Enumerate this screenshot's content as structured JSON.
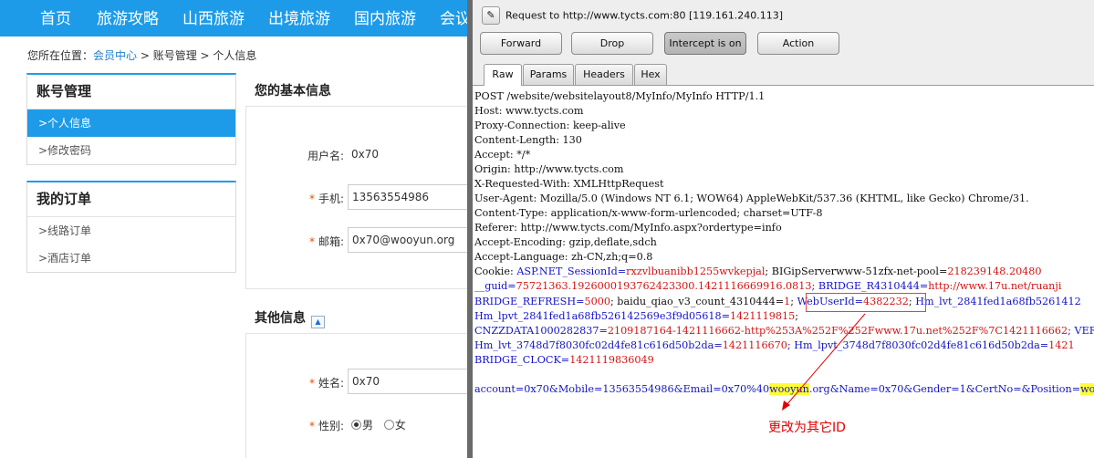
{
  "site": {
    "nav": [
      "首页",
      "旅游攻略",
      "山西旅游",
      "出境旅游",
      "国内旅游",
      "会议"
    ],
    "breadcrumb": {
      "prefix": "您所在位置：",
      "link": "会员中心",
      "sep": " > ",
      "item1": "账号管理",
      "item2": "个人信息"
    },
    "account_box": {
      "title": "账号管理",
      "items": [
        "个人信息",
        "修改密码"
      ]
    },
    "orders_box": {
      "title": "我的订单",
      "items": [
        "线路订单",
        "酒店订单"
      ]
    },
    "basic_info": {
      "title": "您的基本信息",
      "username_label": "用户名:",
      "username_value": "0x70",
      "phone_label": "手机:",
      "phone_value": "13563554986",
      "email_label": "邮箱:",
      "email_value": "0x70@wooyun.org"
    },
    "other_info": {
      "title": "其他信息",
      "name_label": "姓名:",
      "name_value": "0x70",
      "gender_label": "性别:",
      "gender_male": "男",
      "gender_female": "女"
    },
    "required_mark": "*",
    "chevron": ">",
    "collapse_glyph": "▲"
  },
  "burp": {
    "request_line": "Request to http://www.tycts.com:80  [119.161.240.113]",
    "pencil_glyph": "✎",
    "buttons": [
      "Forward",
      "Drop",
      "Intercept is on",
      "Action"
    ],
    "tabs": [
      "Raw",
      "Params",
      "Headers",
      "Hex"
    ],
    "lines": [
      "POST /website/websitelayout8/MyInfo/MyInfo HTTP/1.1",
      "Host: www.tycts.com",
      "Proxy-Connection: keep-alive",
      "Content-Length: 130",
      "Accept: */*",
      "Origin: http://www.tycts.com",
      "X-Requested-With: XMLHttpRequest",
      "User-Agent: Mozilla/5.0 (Windows NT 6.1; WOW64) AppleWebKit/537.36 (KHTML, like Gecko) Chrome/31.",
      "Content-Type: application/x-www-form-urlencoded; charset=UTF-8",
      "Referer: http://www.tycts.com/MyInfo.aspx?ordertype=info",
      "Accept-Encoding: gzip,deflate,sdch",
      "Accept-Language: zh-CN,zh;q=0.8"
    ],
    "cookie": {
      "l1_label": "Cookie: ",
      "l1_a": "ASP.NET_SessionId=",
      "l1_b": "rxzvlbuanibb1255wvkepjal",
      "l1_c": "; BIGipServerwww-51zfx-net-pool=",
      "l1_d": "218239148.20480",
      "l2_a": "__guid=",
      "l2_b": "75721363.1926000193762423300.1421116669916.0813",
      "l2_c": "; BRIDGE_R4310444=",
      "l2_d": "http://www.17u.net/ruanji",
      "l3_a": "BRIDGE_REFRESH=",
      "l3_b": "5000",
      "l3_c": "; baidu_qiao_v3_count_4310444=",
      "l3_d": "1",
      "l3_e": "; ",
      "l3_f": "WebUserId=",
      "l3_g": "4382232",
      "l3_h": "; ",
      "l3_i": "Hm_lvt_2841fed1a68fb5261412",
      "l4_a": "Hm_lpvt_2841fed1a68fb526142569e3f9d05618=",
      "l4_b": "1421119815",
      "l4_c": ";",
      "l5_a": "CNZZDATA1000282837=",
      "l5_b": "2109187164-1421116662-http%253A%252F%252Fwww.17u.net%252F%7C1421116662",
      "l5_c": "; VERSIO",
      "l6_a": "Hm_lvt_3748d7f8030fc02d4fe81c616d50b2da=",
      "l6_b": "1421116670",
      "l6_c": "; Hm_lpvt_3748d7f8030fc02d4fe81c616d50b2da=",
      "l6_d": "1421",
      "l7_a": "BRIDGE_CLOCK=",
      "l7_b": "1421119836049"
    },
    "body": {
      "a": "account=0x70&Mobile=13563554986&Email=0x70%40",
      "b": "wooyun",
      "c": ".org&Name=0x70&Gender=1&CertNo=&Position=",
      "d": "wooyu"
    },
    "annotation": "更改为其它ID"
  }
}
